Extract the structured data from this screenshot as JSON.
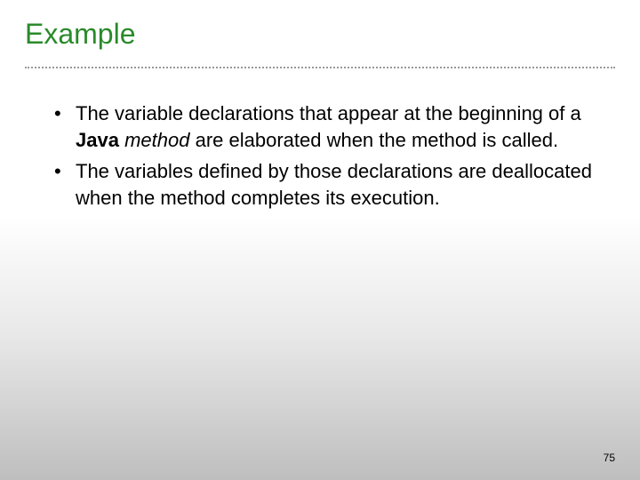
{
  "title": "Example",
  "bullets": {
    "b1_part1": "The variable declarations that appear at the beginning of a ",
    "b1_bold": "Java",
    "b1_space": " ",
    "b1_italic": "method",
    "b1_part2": " are elaborated when the method is called.",
    "b2": "The variables defined by those declarations are deallocated when the method completes its execution."
  },
  "page_number": "75"
}
